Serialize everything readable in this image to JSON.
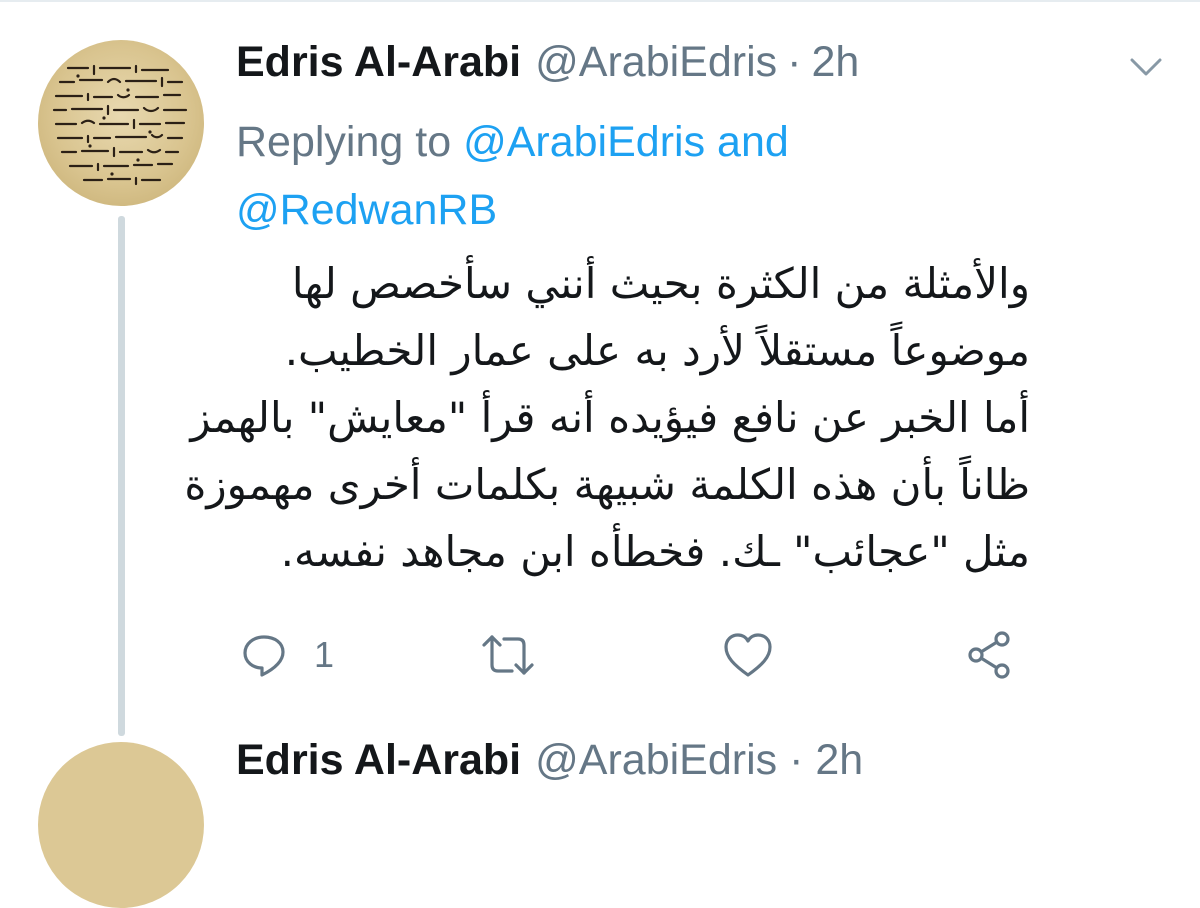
{
  "tweet": {
    "display_name": "Edris Al-Arabi",
    "handle": "@ArabiEdris",
    "separator": "·",
    "time": "2h",
    "reply_prefix": "Replying to ",
    "reply_mention_1": "@ArabiEdris",
    "reply_and": "and",
    "reply_mention_2": "@RedwanRB",
    "text_lines": [
      "والأمثلة من الكثرة بحيث أنني سأخصص لها",
      "موضوعاً مستقلاً لأرد به على عمار الخطيب.",
      "أما الخبر عن نافع فيؤيده أنه قرأ \"معايش\" بالهمز",
      "ظاناً بأن هذه الكلمة شبيهة بكلمات أخرى مهموزة",
      "مثل \"عجائب\" ـك. فخطأه ابن مجاهد نفسه."
    ],
    "avatar_icon": "manuscript-avatar",
    "menu_icon": "chevron-down-icon"
  },
  "actions": {
    "reply_icon": "reply-icon",
    "reply_count": "1",
    "retweet_icon": "retweet-icon",
    "like_icon": "heart-icon",
    "share_icon": "share-icon"
  },
  "next_tweet": {
    "display_name": "Edris Al-Arabi",
    "handle": "@ArabiEdris · 2h"
  },
  "colors": {
    "text": "#14171a",
    "secondary": "#657786",
    "link": "#1da1f2",
    "thread_line": "#cfd9de"
  }
}
